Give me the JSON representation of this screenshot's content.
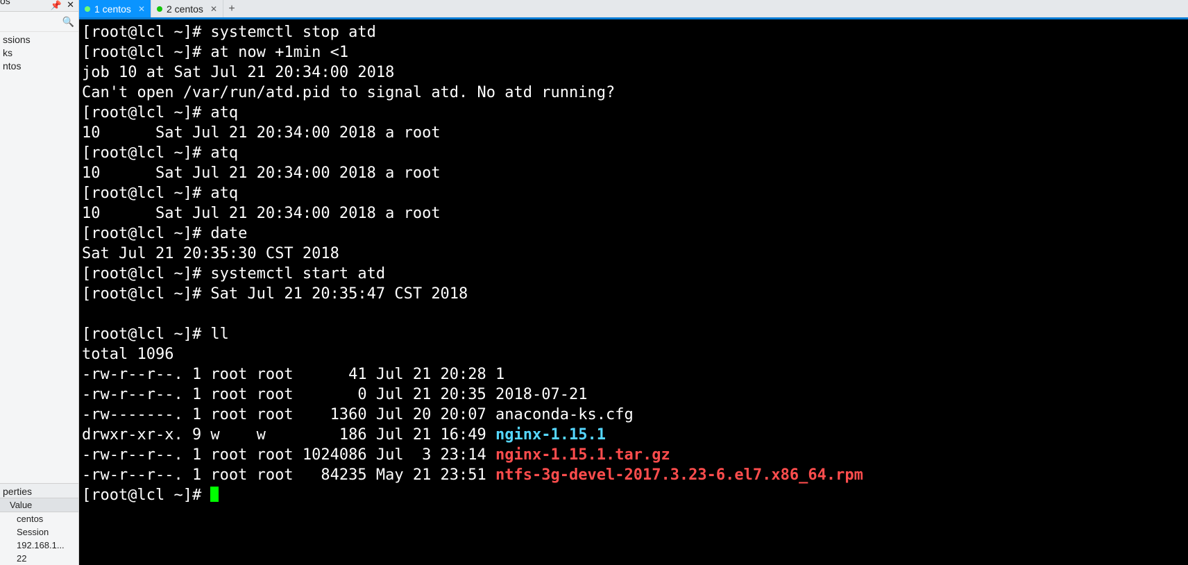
{
  "left": {
    "title_fragment": "os",
    "pin_glyph": "📌",
    "close_glyph": "✕",
    "search_glyph": "🔍",
    "items": [
      "ssions",
      "ks",
      "ntos"
    ],
    "properties_label": "perties",
    "col_header": "Value",
    "rows": [
      "centos",
      "Session",
      "192.168.1...",
      "22"
    ]
  },
  "tabs": {
    "items": [
      {
        "label": "1 centos",
        "active": true
      },
      {
        "label": "2 centos",
        "active": false
      }
    ],
    "add_glyph": "+"
  },
  "terminal": {
    "prompt_user": "root",
    "prompt_host": "lcl",
    "prompt_path": "~",
    "prompt_symbol": "#",
    "lines": [
      {
        "type": "cmd",
        "text": "systemctl stop atd"
      },
      {
        "type": "cmd",
        "text": "at now +1min <1"
      },
      {
        "type": "out",
        "text": "job 10 at Sat Jul 21 20:34:00 2018"
      },
      {
        "type": "out",
        "text": "Can't open /var/run/atd.pid to signal atd. No atd running?"
      },
      {
        "type": "cmd",
        "text": "atq"
      },
      {
        "type": "out",
        "text": "10      Sat Jul 21 20:34:00 2018 a root"
      },
      {
        "type": "cmd",
        "text": "atq"
      },
      {
        "type": "out",
        "text": "10      Sat Jul 21 20:34:00 2018 a root"
      },
      {
        "type": "cmd",
        "text": "atq"
      },
      {
        "type": "out",
        "text": "10      Sat Jul 21 20:34:00 2018 a root"
      },
      {
        "type": "cmd",
        "text": "date"
      },
      {
        "type": "out",
        "text": "Sat Jul 21 20:35:30 CST 2018"
      },
      {
        "type": "cmd",
        "text": "systemctl start atd"
      },
      {
        "type": "cmd",
        "text": "Sat Jul 21 20:35:47 CST 2018"
      },
      {
        "type": "blank"
      },
      {
        "type": "cmd",
        "text": "ll"
      },
      {
        "type": "out",
        "text": "total 1096"
      },
      {
        "type": "ls",
        "perm": "-rw-r--r--.",
        "links": "1",
        "owner": "root",
        "group": "root",
        "size": "41",
        "date": "Jul 21 20:28",
        "name": "1",
        "color": ""
      },
      {
        "type": "ls",
        "perm": "-rw-r--r--.",
        "links": "1",
        "owner": "root",
        "group": "root",
        "size": "0",
        "date": "Jul 21 20:35",
        "name": "2018-07-21",
        "color": ""
      },
      {
        "type": "ls",
        "perm": "-rw-------.",
        "links": "1",
        "owner": "root",
        "group": "root",
        "size": "1360",
        "date": "Jul 20 20:07",
        "name": "anaconda-ks.cfg",
        "color": ""
      },
      {
        "type": "ls",
        "perm": "drwxr-xr-x.",
        "links": "9",
        "owner": "w",
        "group": "w",
        "size": "186",
        "date": "Jul 21 16:49",
        "name": "nginx-1.15.1",
        "color": "cyan"
      },
      {
        "type": "ls",
        "perm": "-rw-r--r--.",
        "links": "1",
        "owner": "root",
        "group": "root",
        "size": "1024086",
        "date": "Jul  3 23:14",
        "name": "nginx-1.15.1.tar.gz",
        "color": "red"
      },
      {
        "type": "ls",
        "perm": "-rw-r--r--.",
        "links": "1",
        "owner": "root",
        "group": "root",
        "size": "84235",
        "date": "May 21 23:51",
        "name": "ntfs-3g-devel-2017.3.23-6.el7.x86_64.rpm",
        "color": "red"
      },
      {
        "type": "prompt_only"
      }
    ]
  }
}
